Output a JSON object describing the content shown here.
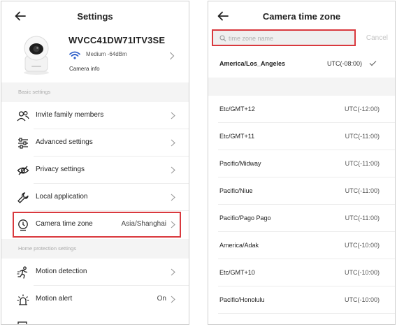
{
  "settings": {
    "title": "Settings",
    "camera": {
      "name": "WVCC41DW71ITV3SE",
      "signal": "Medium -64dBm",
      "info_label": "Camera info"
    },
    "sections": {
      "basic": "Basic settings",
      "home_protection": "Home protection settings"
    },
    "items": [
      {
        "label": "Invite family members",
        "icon": "people-icon"
      },
      {
        "label": "Advanced settings",
        "icon": "sliders-icon"
      },
      {
        "label": "Privacy settings",
        "icon": "eye-off-icon"
      },
      {
        "label": "Local application",
        "icon": "wrench-icon"
      },
      {
        "label": "Camera time zone",
        "value": "Asia/Shanghai",
        "icon": "clock-icon",
        "highlighted": true
      },
      {
        "label": "Motion detection",
        "icon": "running-icon"
      },
      {
        "label": "Motion alert",
        "value": "On",
        "icon": "alarm-icon"
      }
    ]
  },
  "timezone": {
    "title": "Camera time zone",
    "search_placeholder": "time zone name",
    "cancel_label": "Cancel",
    "selected": {
      "name": "America/Los_Angeles",
      "offset": "UTC(-08:00)"
    },
    "zones": [
      {
        "name": "Etc/GMT+12",
        "offset": "UTC(-12:00)"
      },
      {
        "name": "Etc/GMT+11",
        "offset": "UTC(-11:00)"
      },
      {
        "name": "Pacific/Midway",
        "offset": "UTC(-11:00)"
      },
      {
        "name": "Pacific/Niue",
        "offset": "UTC(-11:00)"
      },
      {
        "name": "Pacific/Pago Pago",
        "offset": "UTC(-11:00)"
      },
      {
        "name": "America/Adak",
        "offset": "UTC(-10:00)"
      },
      {
        "name": "Etc/GMT+10",
        "offset": "UTC(-10:00)"
      },
      {
        "name": "Pacific/Honolulu",
        "offset": "UTC(-10:00)"
      }
    ]
  },
  "colors": {
    "highlight": "#d9393e",
    "wifi": "#2f5fc9",
    "section_bg": "#f4f4f4"
  }
}
